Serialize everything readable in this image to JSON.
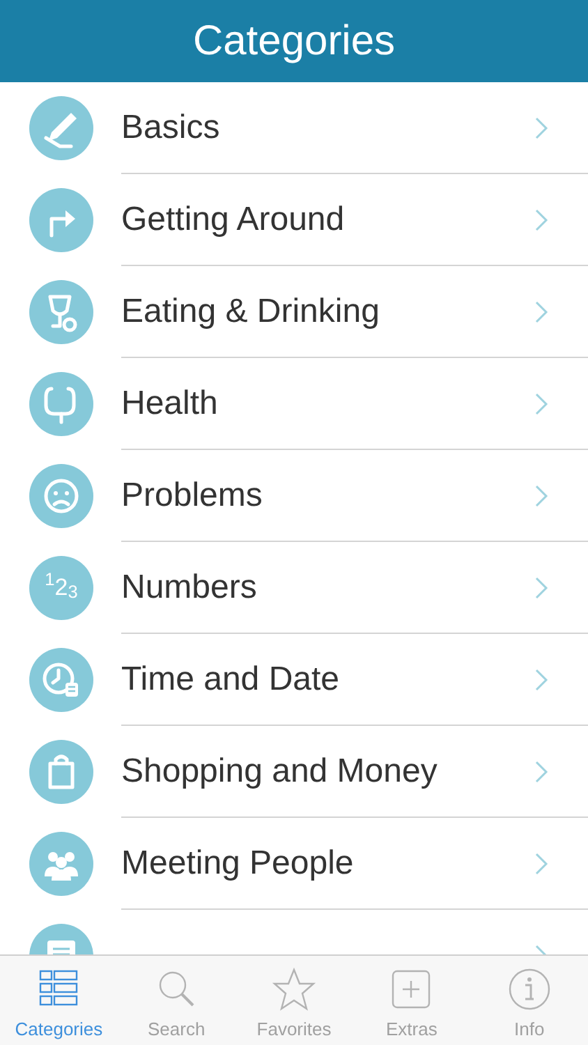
{
  "header": {
    "title": "Categories"
  },
  "categories": [
    {
      "label": "Basics"
    },
    {
      "label": "Getting Around"
    },
    {
      "label": "Eating & Drinking"
    },
    {
      "label": "Health"
    },
    {
      "label": "Problems"
    },
    {
      "label": "Numbers",
      "icon_text": "$^{1}$2$_{3}$"
    },
    {
      "label": "Time and Date"
    },
    {
      "label": "Shopping and Money"
    },
    {
      "label": "Meeting People"
    },
    {
      "kind": "cut_off"
    }
  ],
  "tab_bar": [
    {
      "label": "Categories",
      "selected": true
    },
    {
      "label": "Search",
      "selected": false
    },
    {
      "label": "Favorites",
      "selected": false
    },
    {
      "label": "Extras",
      "selected": false
    },
    {
      "label": "Info",
      "selected": false
    }
  ]
}
